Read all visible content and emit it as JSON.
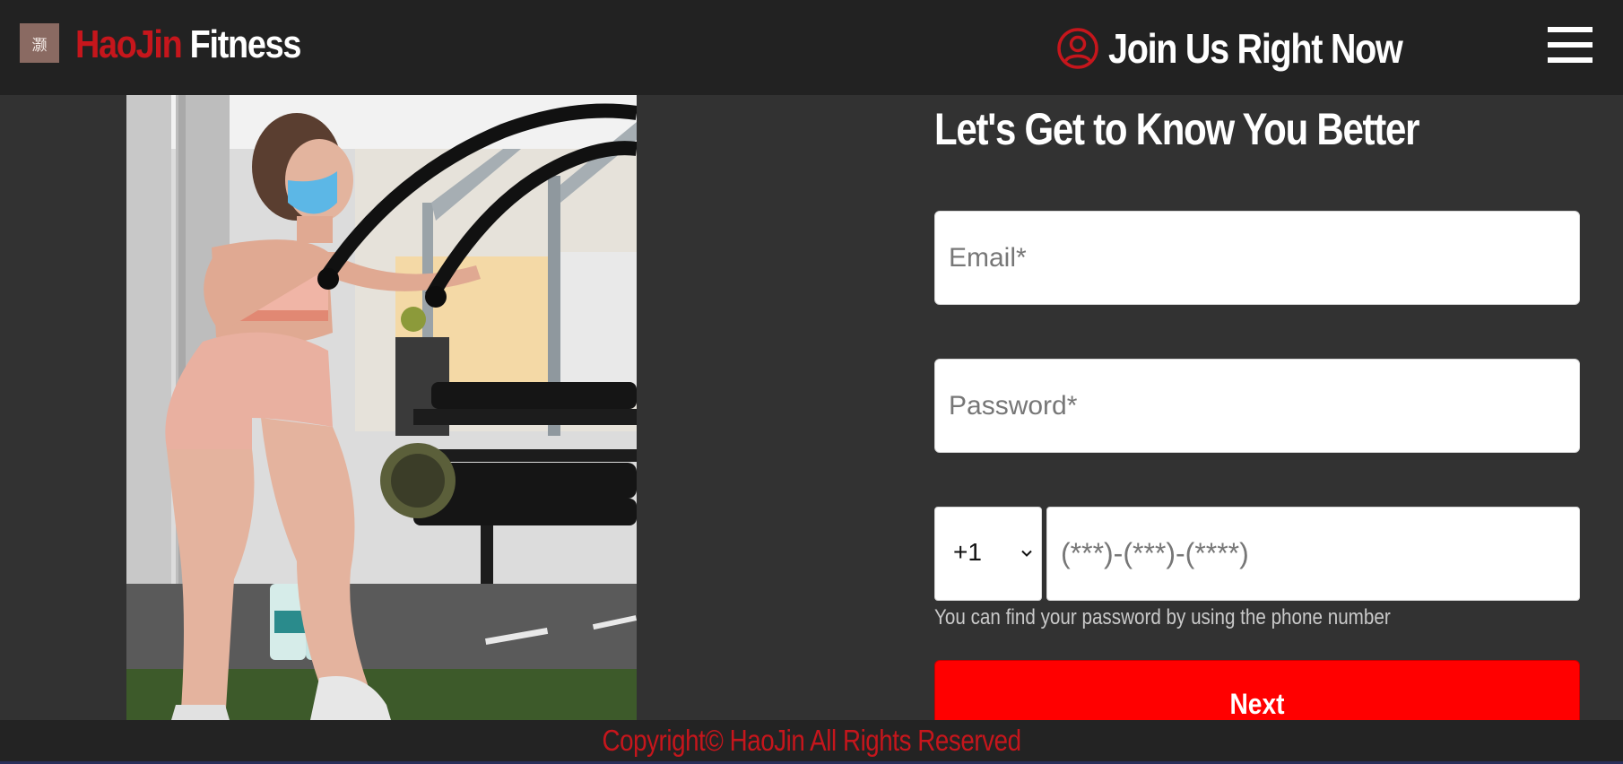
{
  "header": {
    "logo_glyph": "灏",
    "brand_part1": "HaoJin",
    "brand_part2": " Fitness",
    "join_label": "Join Us Right Now",
    "account_icon": "user-circle-icon",
    "menu_icon": "hamburger-menu-icon"
  },
  "hero": {
    "image_description_icon": "fitness-photo"
  },
  "form": {
    "title": "Let's Get to Know You Better",
    "email_placeholder": "Email*",
    "password_placeholder": "Password*",
    "country_code": "+1",
    "phone_placeholder": "(***)-(***)-(****)",
    "help_text": "You can find your password by using the phone number",
    "next_label": "Next"
  },
  "footer": {
    "copyright": "Copyright© HaoJin All Rights Reserved"
  },
  "colors": {
    "brand_red": "#c6161c",
    "button_red": "#ff0000",
    "header_bg": "#222222",
    "page_bg": "#323232"
  }
}
